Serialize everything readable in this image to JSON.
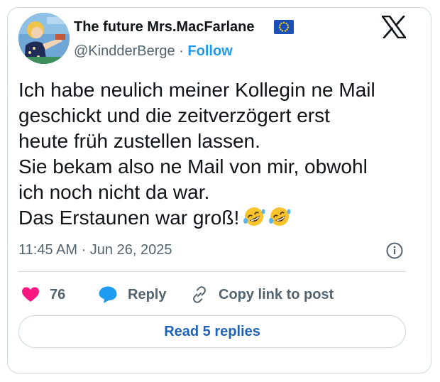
{
  "author": {
    "display_name": "The future Mrs.MacFarlane",
    "handle": "@KindderBerge",
    "separator": " · ",
    "follow_label": "Follow"
  },
  "tweet": {
    "text": "Ich habe neulich meiner Kollegin ne Mail\ngeschickt und die zeitverzögert erst\nheute früh zustellen lassen.\nSie bekam also ne Mail von mir, obwohl\nich noch nicht da war.\nDas Erstaunen war groß!",
    "emojis": [
      "rolling-on-floor-laughing",
      "rolling-on-floor-laughing"
    ],
    "timestamp": "11:45 AM · Jun 26, 2025"
  },
  "actions": {
    "like_count": "76",
    "reply_label": "Reply",
    "copy_label": "Copy link to post"
  },
  "read_replies_label": "Read 5 replies",
  "colors": {
    "accent": "#1d9bf0",
    "like": "#f91880",
    "reply_icon": "#1d9bf0",
    "read_replies_text": "#1d63b8",
    "muted": "#536471",
    "border": "#cfd9de"
  }
}
